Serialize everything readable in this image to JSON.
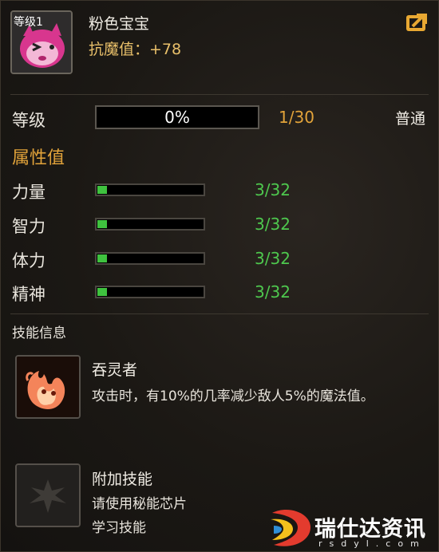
{
  "pet": {
    "level_badge": "等级1",
    "name": "粉色宝宝",
    "resist_text": "抗魔值：+78",
    "icon": "pink-pet-portrait"
  },
  "header": {
    "share_icon": "share-icon"
  },
  "level": {
    "label": "等级",
    "exp_percent_text": "0%",
    "exp_fraction": 0,
    "value": "1/30",
    "quality": "普通"
  },
  "attributes": {
    "heading": "属性值",
    "items": [
      {
        "label": "力量",
        "value": "3/32",
        "fill": 0.09
      },
      {
        "label": "智力",
        "value": "3/32",
        "fill": 0.09
      },
      {
        "label": "体力",
        "value": "3/32",
        "fill": 0.09
      },
      {
        "label": "精神",
        "value": "3/32",
        "fill": 0.09
      }
    ]
  },
  "skills": {
    "heading": "技能信息",
    "main": {
      "name": "吞灵者",
      "desc": "攻击时，有10%的几率减少敌人5%的魔法值。",
      "icon": "flame-skill-icon"
    },
    "extra": {
      "name": "附加技能",
      "line1": "请使用秘能芯片",
      "line2": "学习技能",
      "icon": "empty-skill-slot-icon"
    }
  },
  "watermark": {
    "text": "瑞仕达资讯",
    "sub": "rsdyl.com"
  },
  "colors": {
    "gold": "#e2a33a",
    "green": "#4ec84e",
    "text": "#e8e4dc"
  }
}
